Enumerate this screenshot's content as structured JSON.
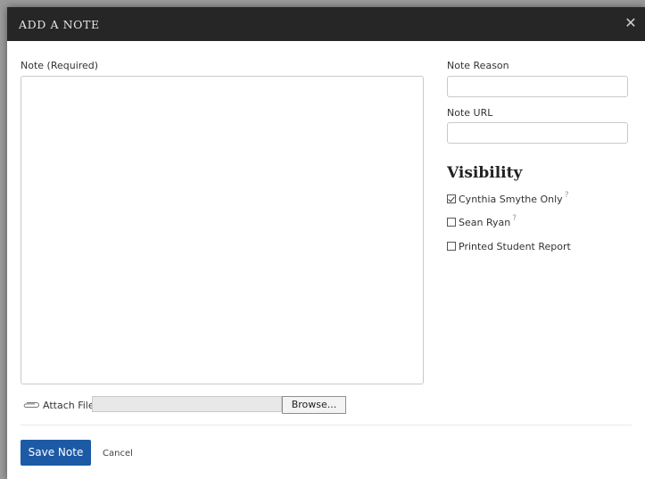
{
  "dialog": {
    "title": "ADD A NOTE",
    "close_glyph": "✕"
  },
  "note": {
    "label": "Note (Required)",
    "value": ""
  },
  "note_reason": {
    "label": "Note Reason",
    "value": ""
  },
  "note_url": {
    "label": "Note URL",
    "value": ""
  },
  "visibility": {
    "heading": "Visibility",
    "options": [
      {
        "label": "Cynthia Smythe Only",
        "checked": true,
        "help": "?"
      },
      {
        "label": "Sean Ryan",
        "checked": false,
        "help": "?"
      },
      {
        "label": "Printed Student Report",
        "checked": false,
        "help": ""
      }
    ]
  },
  "attach": {
    "label": "Attach File",
    "file_path": "",
    "browse_label": "Browse...",
    "icon": "paperclip-icon"
  },
  "actions": {
    "save_label": "Save Note",
    "cancel_label": "Cancel"
  },
  "colors": {
    "titlebar": "#262626",
    "primary": "#1d5aa6"
  }
}
